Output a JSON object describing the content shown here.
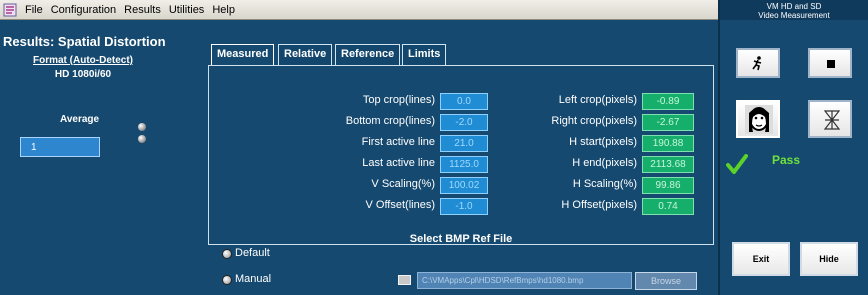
{
  "menubar": {
    "items": [
      "File",
      "Configuration",
      "Results",
      "Utilities",
      "Help"
    ],
    "icon": "app-glyph-icon"
  },
  "left": {
    "page_title": "Results: Spatial Distortion",
    "format_label": "Format (Auto-Detect)",
    "format_value": "HD 1080i/60",
    "average_label": "Average",
    "average_value": "1"
  },
  "tabs": [
    {
      "label": "Measured",
      "active": true
    },
    {
      "label": "Relative",
      "active": false
    },
    {
      "label": "Reference",
      "active": false
    },
    {
      "label": "Limits",
      "active": false
    }
  ],
  "measurements": {
    "left": [
      {
        "label": "Top crop(lines)",
        "value": "0.0"
      },
      {
        "label": "Bottom crop(lines)",
        "value": "-2.0"
      },
      {
        "label": "First active line",
        "value": "21.0"
      },
      {
        "label": "Last active line",
        "value": "1125.0"
      },
      {
        "label": "V Scaling(%)",
        "value": "100.02"
      },
      {
        "label": "V Offset(lines)",
        "value": "-1.0"
      }
    ],
    "right": [
      {
        "label": "Left crop(pixels)",
        "value": "-0.89"
      },
      {
        "label": "Right crop(pixels)",
        "value": "-2.67"
      },
      {
        "label": "H start(pixels)",
        "value": "190.88"
      },
      {
        "label": "H end(pixels)",
        "value": "2113.68"
      },
      {
        "label": "H Scaling(%)",
        "value": "99.86"
      },
      {
        "label": "H Offset(pixels)",
        "value": "0.74"
      }
    ]
  },
  "ref_file": {
    "title": "Select BMP Ref File",
    "option_default": "Default",
    "option_manual": "Manual",
    "path": "C:\\VMApps\\Cpl\\HDSD\\RefBmps\\hd1080.bmp",
    "browse_label": "Browse"
  },
  "right_panel": {
    "title_line1": "VM HD and SD",
    "title_line2": "Video Measurement",
    "pass_label": "Pass",
    "exit_label": "Exit",
    "hide_label": "Hide"
  },
  "colors": {
    "background": "#16496f",
    "value_blue": "#1f8cd3",
    "value_green": "#15ae6a",
    "pass_green": "#6fe23a"
  }
}
